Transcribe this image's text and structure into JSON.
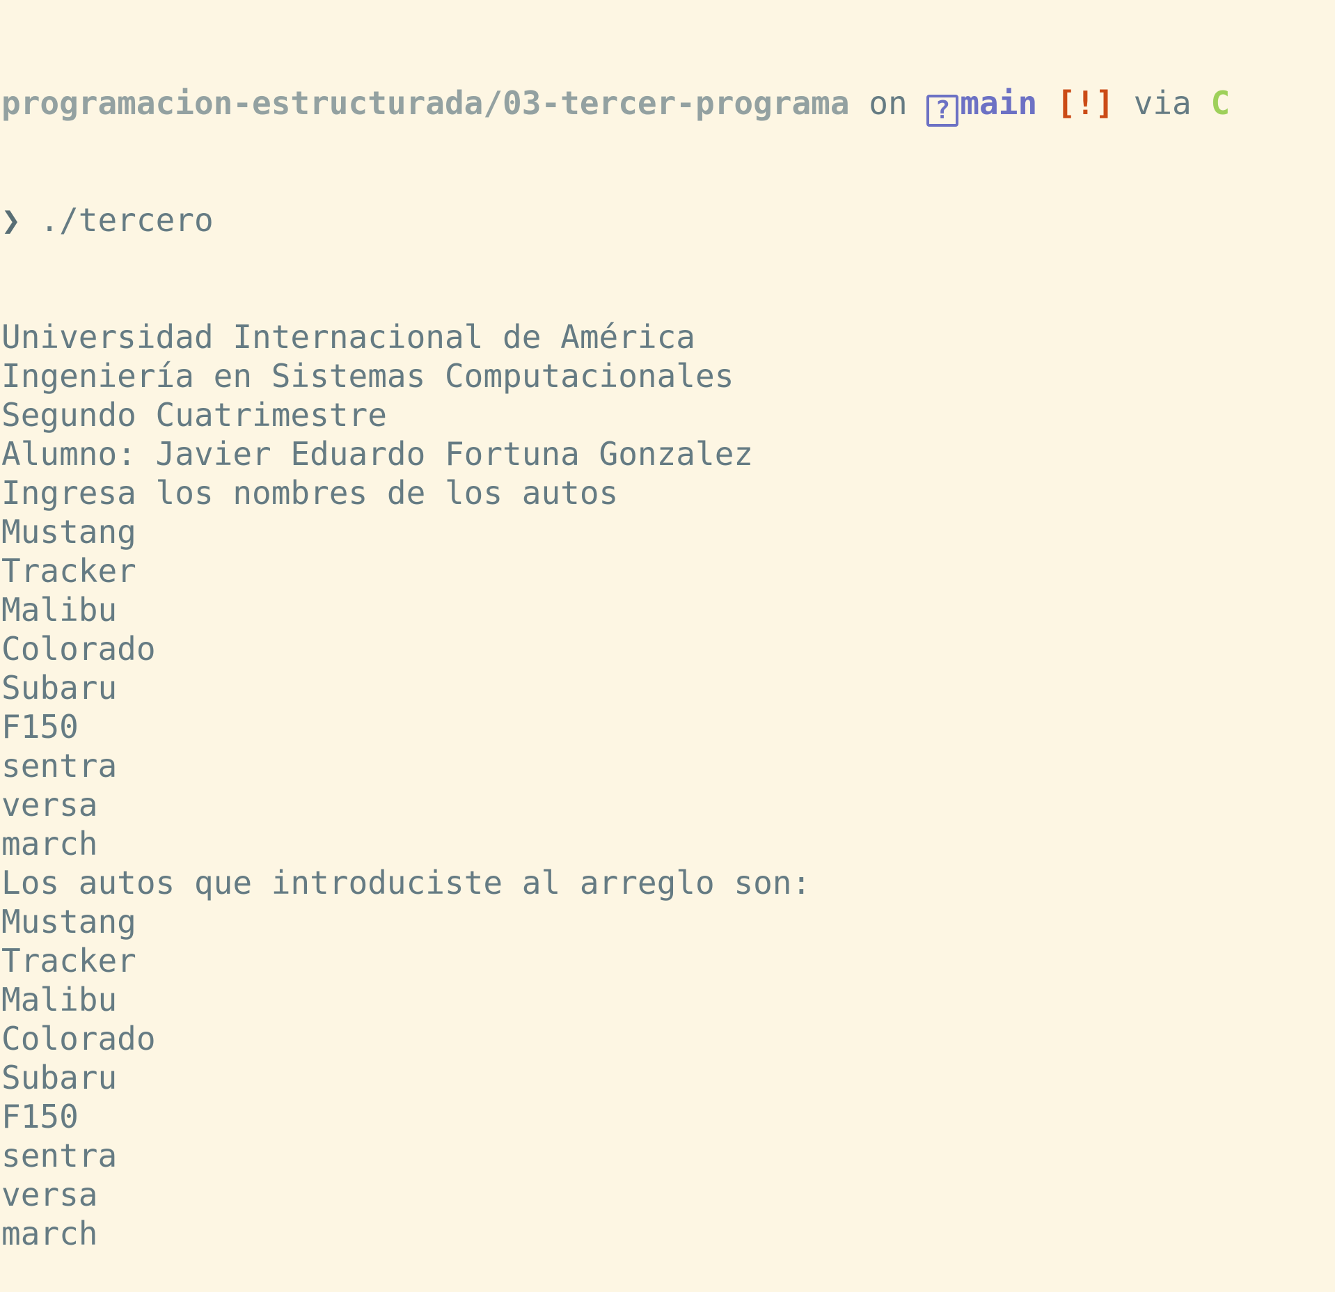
{
  "prompt": {
    "path": "programacion-estructurada/03-tercer-programa",
    "on_text": "on",
    "branch_icon": "?",
    "branch": "main",
    "status": "[!]",
    "via_text": "via",
    "language": "C",
    "prompt_symbol": "❯",
    "command": "./tercero"
  },
  "output": [
    "Universidad Internacional de América",
    "Ingeniería en Sistemas Computacionales",
    "Segundo Cuatrimestre",
    "Alumno: Javier Eduardo Fortuna Gonzalez",
    "Ingresa los nombres de los autos",
    "Mustang",
    "Tracker",
    "Malibu",
    "Colorado",
    "Subaru",
    "F150",
    "sentra",
    "versa",
    "march",
    "Los autos que introduciste al arreglo son:",
    "Mustang",
    "Tracker",
    "Malibu",
    "Colorado",
    "Subaru",
    "F150",
    "sentra",
    "versa",
    "march"
  ],
  "colors": {
    "background": "#fdf6e3",
    "text": "#657b83",
    "path": "#93a1a1",
    "branch": "#6c71c4",
    "status": "#cb4b16",
    "language": "#9ed05a"
  }
}
